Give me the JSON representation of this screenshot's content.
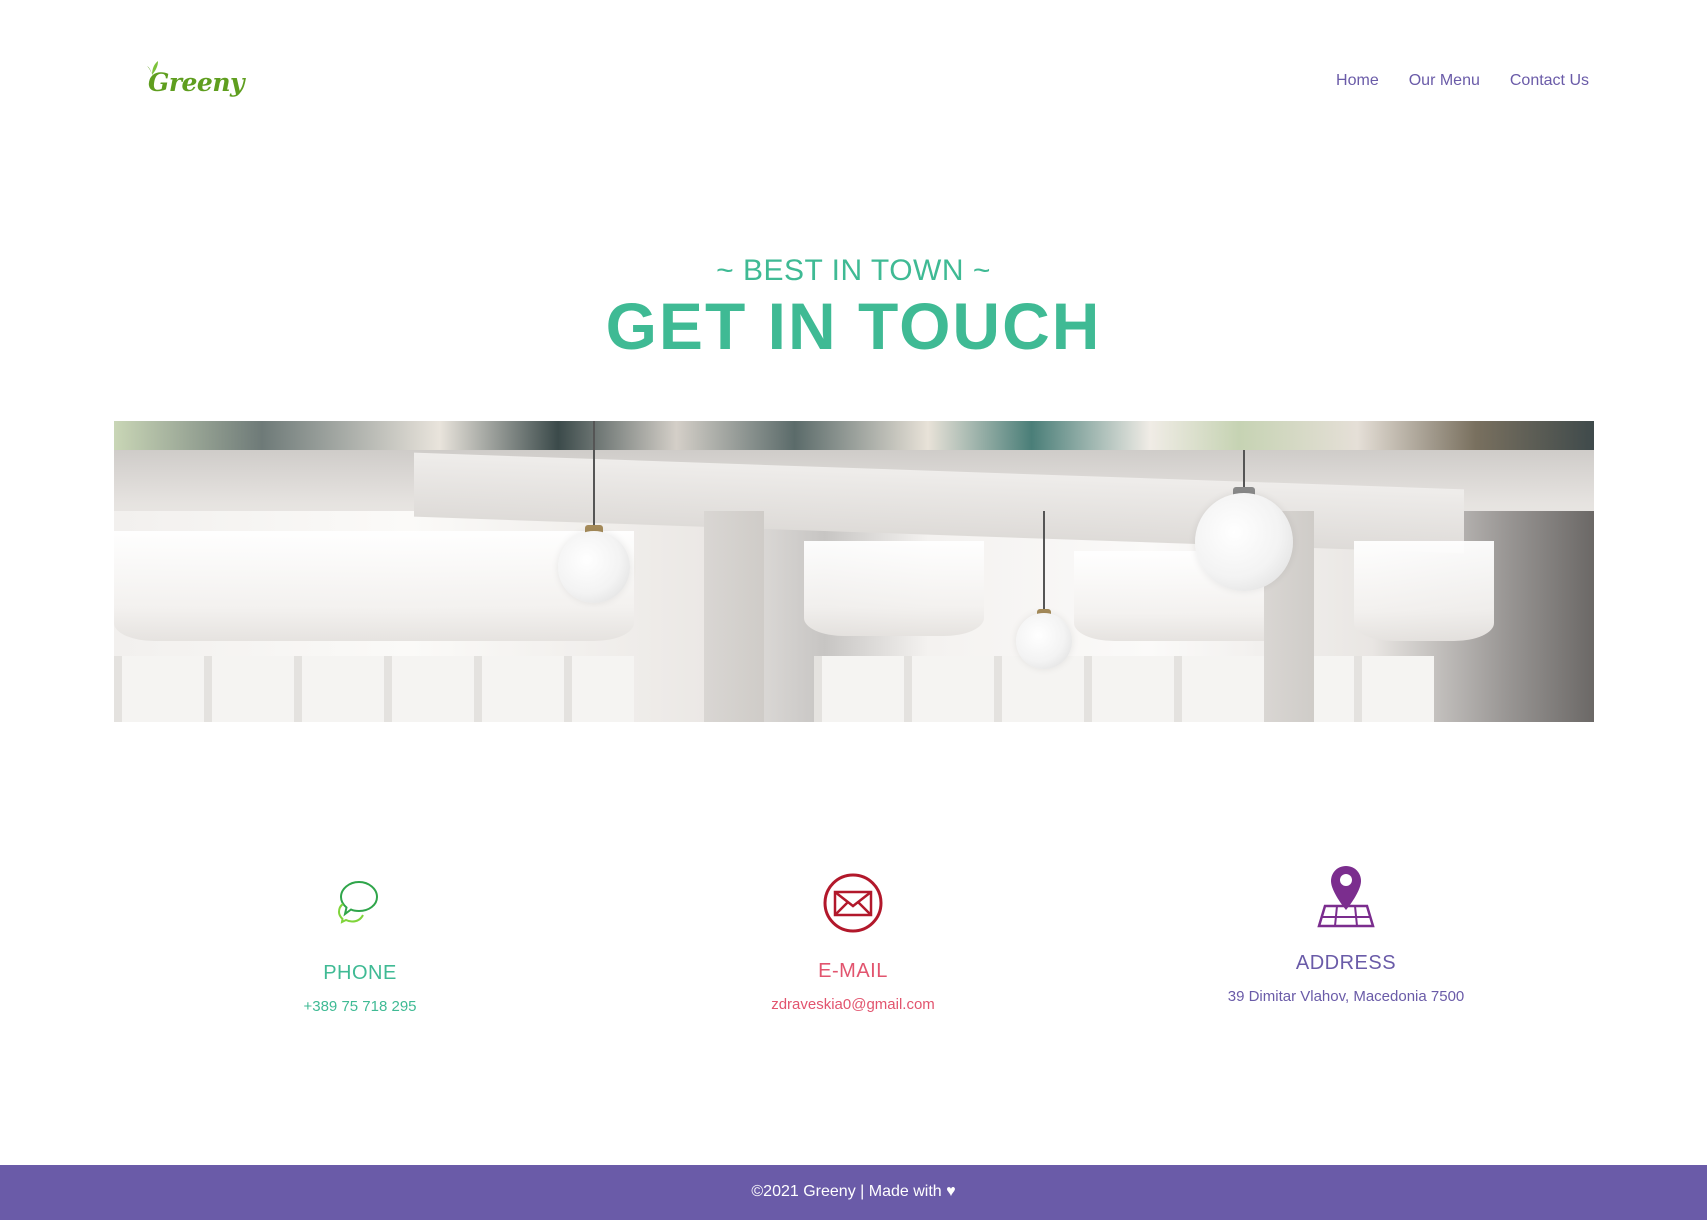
{
  "header": {
    "logo_text": "Greeny",
    "nav": [
      {
        "label": "Home"
      },
      {
        "label": "Our Menu"
      },
      {
        "label": "Contact Us"
      }
    ]
  },
  "hero": {
    "subtitle": "~ BEST IN TOWN ~",
    "title": "GET IN TOUCH"
  },
  "contact": {
    "phone": {
      "icon": "chat-bubbles-icon",
      "title": "PHONE",
      "value": "+389 75 718 295"
    },
    "email": {
      "icon": "envelope-icon",
      "title": "E-MAIL",
      "value": "zdraveskia0@gmail.com"
    },
    "address": {
      "icon": "map-pin-icon",
      "title": "ADDRESS",
      "value": "39 Dimitar Vlahov, Macedonia 7500"
    }
  },
  "footer": {
    "text": "©2021 Greeny | Made with ♥"
  },
  "colors": {
    "brand_green": "#3fba94",
    "logo_green": "#5f9e1f",
    "purple": "#6a5ba8",
    "email_red": "#e2546e",
    "icon_red": "#b2182b",
    "icon_purple": "#7b2d8e"
  }
}
